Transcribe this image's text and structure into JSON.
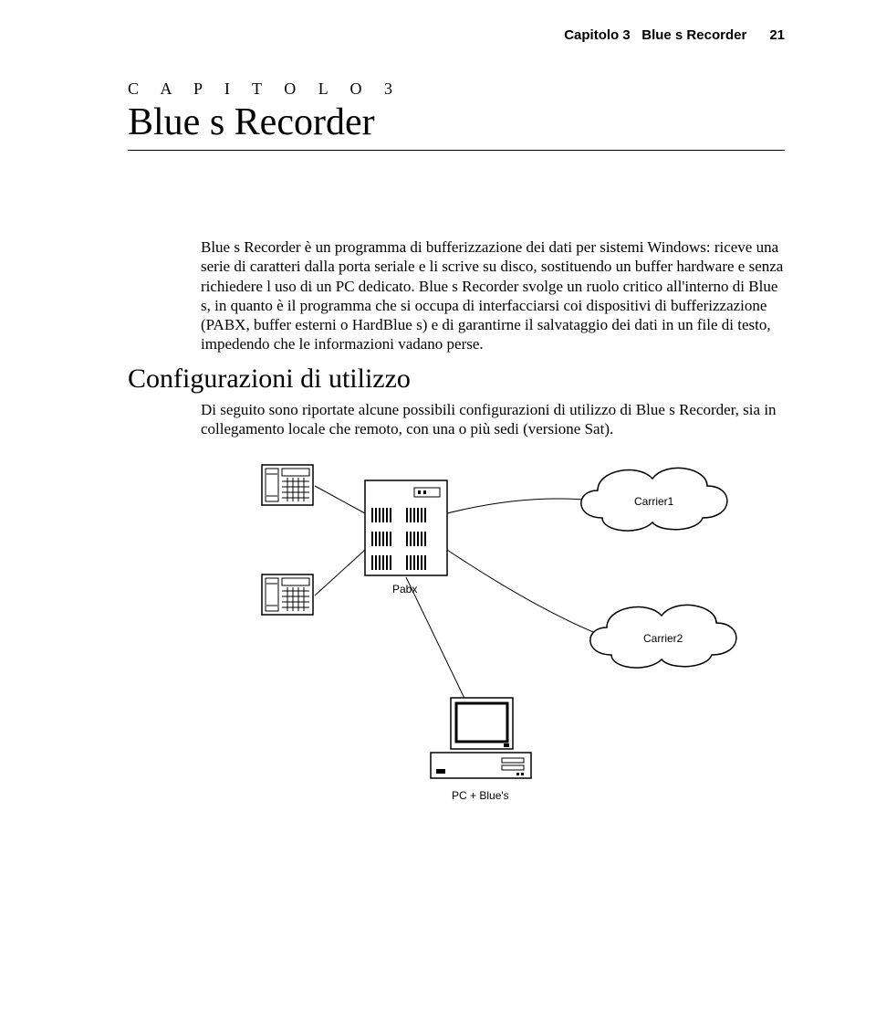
{
  "header": {
    "chapter_ref": "Capitolo 3",
    "chapter_name": "Blue s Recorder",
    "page_number": "21"
  },
  "chapter": {
    "label": "C A P I T O L O  3",
    "title": "Blue s Recorder"
  },
  "intro_paragraph": "Blue s Recorder è un programma di bufferizzazione dei dati per sistemi Windows: riceve una serie di caratteri dalla porta seriale e li scrive su disco, sostituendo un buffer hardware e senza richiedere l uso di un PC dedicato. Blue s Recorder svolge un ruolo critico all'interno di Blue s, in quanto è il programma che si occupa di interfacciarsi coi dispositivi di bufferizzazione (PABX, buffer esterni o HardBlue s) e di garantirne il salvataggio dei dati in un file di testo, impedendo che le informazioni vadano perse.",
  "section": {
    "heading": "Configurazioni di utilizzo",
    "paragraph": "Di seguito sono riportate alcune possibili configurazioni di utilizzo di Blue s Recorder, sia in collegamento locale che remoto, con una o più sedi (versione Sat)."
  },
  "diagram": {
    "phone_top": "",
    "phone_bottom": "",
    "pabx_label": "Pabx",
    "carrier1_label": "Carrier1",
    "carrier2_label": "Carrier2",
    "pc_label": "PC + Blue's"
  }
}
